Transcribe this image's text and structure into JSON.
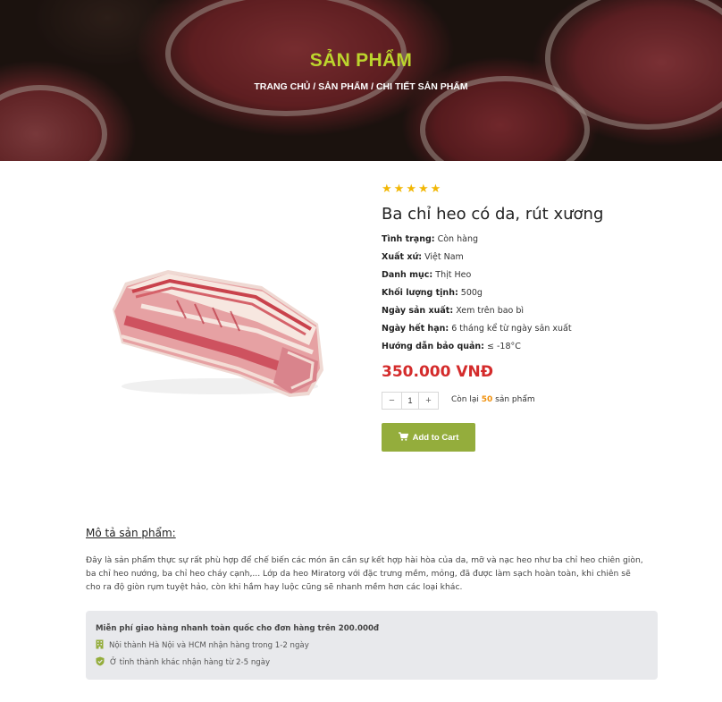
{
  "hero": {
    "title": "SẢN PHẨM",
    "breadcrumb": [
      "TRANG CHỦ",
      "SẢN PHẨM",
      "CHI TIẾT SẢN PHẨM"
    ],
    "separator": " / "
  },
  "product": {
    "rating": 5,
    "name": "Ba chỉ heo có da, rút xương",
    "specs": [
      {
        "label": "Tình trạng:",
        "value": "Còn hàng"
      },
      {
        "label": "Xuất xứ:",
        "value": "Việt Nam"
      },
      {
        "label": "Danh mục:",
        "value": "Thịt Heo"
      },
      {
        "label": "Khối lượng tịnh:",
        "value": "500g"
      },
      {
        "label": "Ngày sản xuất:",
        "value": "Xem trên bao bì"
      },
      {
        "label": "Ngày hết hạn:",
        "value": "6 tháng kể từ ngày sản xuất"
      },
      {
        "label": "Hướng dẫn bảo quản:",
        "value": "≤ -18°C"
      }
    ],
    "price": "350.000 VNĐ",
    "quantity": "1",
    "stock_prefix": "Còn lại",
    "stock_count": "50",
    "stock_suffix": "sản phẩm",
    "add_to_cart_label": "Add to Cart"
  },
  "description": {
    "title": "Mô tả sản phẩm:",
    "text": "Đây là sản phẩm thực sự rất phù hợp để chế biến các món ăn cần sự kết hợp hài hòa của da, mỡ và nạc heo như ba chỉ heo chiên giòn, ba chỉ heo nướng, ba chỉ heo cháy cạnh,... Lớp da heo Miratorg với đặc trưng mềm, mỏng, đã được làm sạch hoàn toàn, khi chiên sẽ cho ra độ giòn rụm tuyệt hảo, còn khi hầm hay luộc cũng sẽ nhanh mềm hơn các loại khác."
  },
  "shipping": {
    "title": "Miễn phí giao hàng nhanh toàn quốc cho đơn hàng trên 200.000đ",
    "lines": [
      {
        "icon": "building-icon",
        "text": "Nội thành Hà Nội và HCM nhận hàng trong 1-2 ngày"
      },
      {
        "icon": "shield-check-icon",
        "text": "Ở tỉnh thành khác nhận hàng từ 2-5 ngày"
      }
    ]
  },
  "colors": {
    "accent_green": "#94ad3c",
    "title_yellow_green": "#bcd52d",
    "price_red": "#d42b2b",
    "star_yellow": "#f2b705",
    "stock_orange": "#f0900c"
  }
}
